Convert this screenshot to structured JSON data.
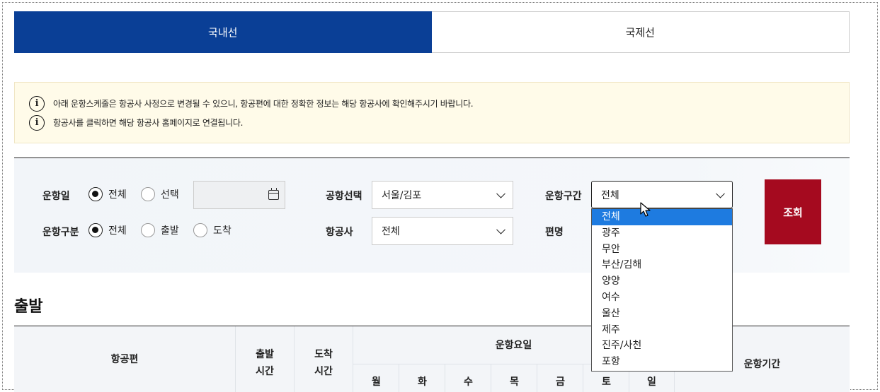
{
  "tabs": [
    {
      "label": "국내선",
      "active": true
    },
    {
      "label": "국제선",
      "active": false
    }
  ],
  "notice": {
    "lines": [
      "아래 운항스케줄은 항공사 사정으로 변경될 수 있으니, 항공편에 대한 정확한 정보는 해당 항공사에 확인해주시기 바랍니다.",
      "항공사를 클릭하면 해당 항공사 홈페이지로 연결됩니다."
    ],
    "icon": "info-icon"
  },
  "filter": {
    "date_label": "운항일",
    "date_options": [
      "전체",
      "선택"
    ],
    "date_selected": "전체",
    "date_value": "",
    "airport_label": "공항선택",
    "airport_value": "서울/김포",
    "route_label": "운항구간",
    "route_value": "전체",
    "type_label": "운항구분",
    "type_options": [
      "전체",
      "출발",
      "도착"
    ],
    "type_selected": "전체",
    "airline_label": "항공사",
    "airline_value": "전체",
    "flight_label": "편명",
    "search_label": "조회"
  },
  "route_dropdown": {
    "options": [
      "전체",
      "광주",
      "무안",
      "부산/김해",
      "양양",
      "여수",
      "울산",
      "제주",
      "진주/사천",
      "포항"
    ],
    "highlighted": "전체"
  },
  "section": {
    "title": "출발"
  },
  "table": {
    "headers": {
      "flight": "항공편",
      "dep_time_1": "출발",
      "dep_time_2": "시간",
      "arr_time_1": "도착",
      "arr_time_2": "시간",
      "days": "운항요일",
      "period": "운항기간"
    },
    "weekdays": [
      "월",
      "화",
      "수",
      "목",
      "금",
      "토",
      "일"
    ]
  },
  "colors": {
    "tab_active": "#0a3f96",
    "search_button": "#a50a1f",
    "dropdown_highlight": "#1e7be0",
    "notice_bg": "#fffbe9"
  }
}
